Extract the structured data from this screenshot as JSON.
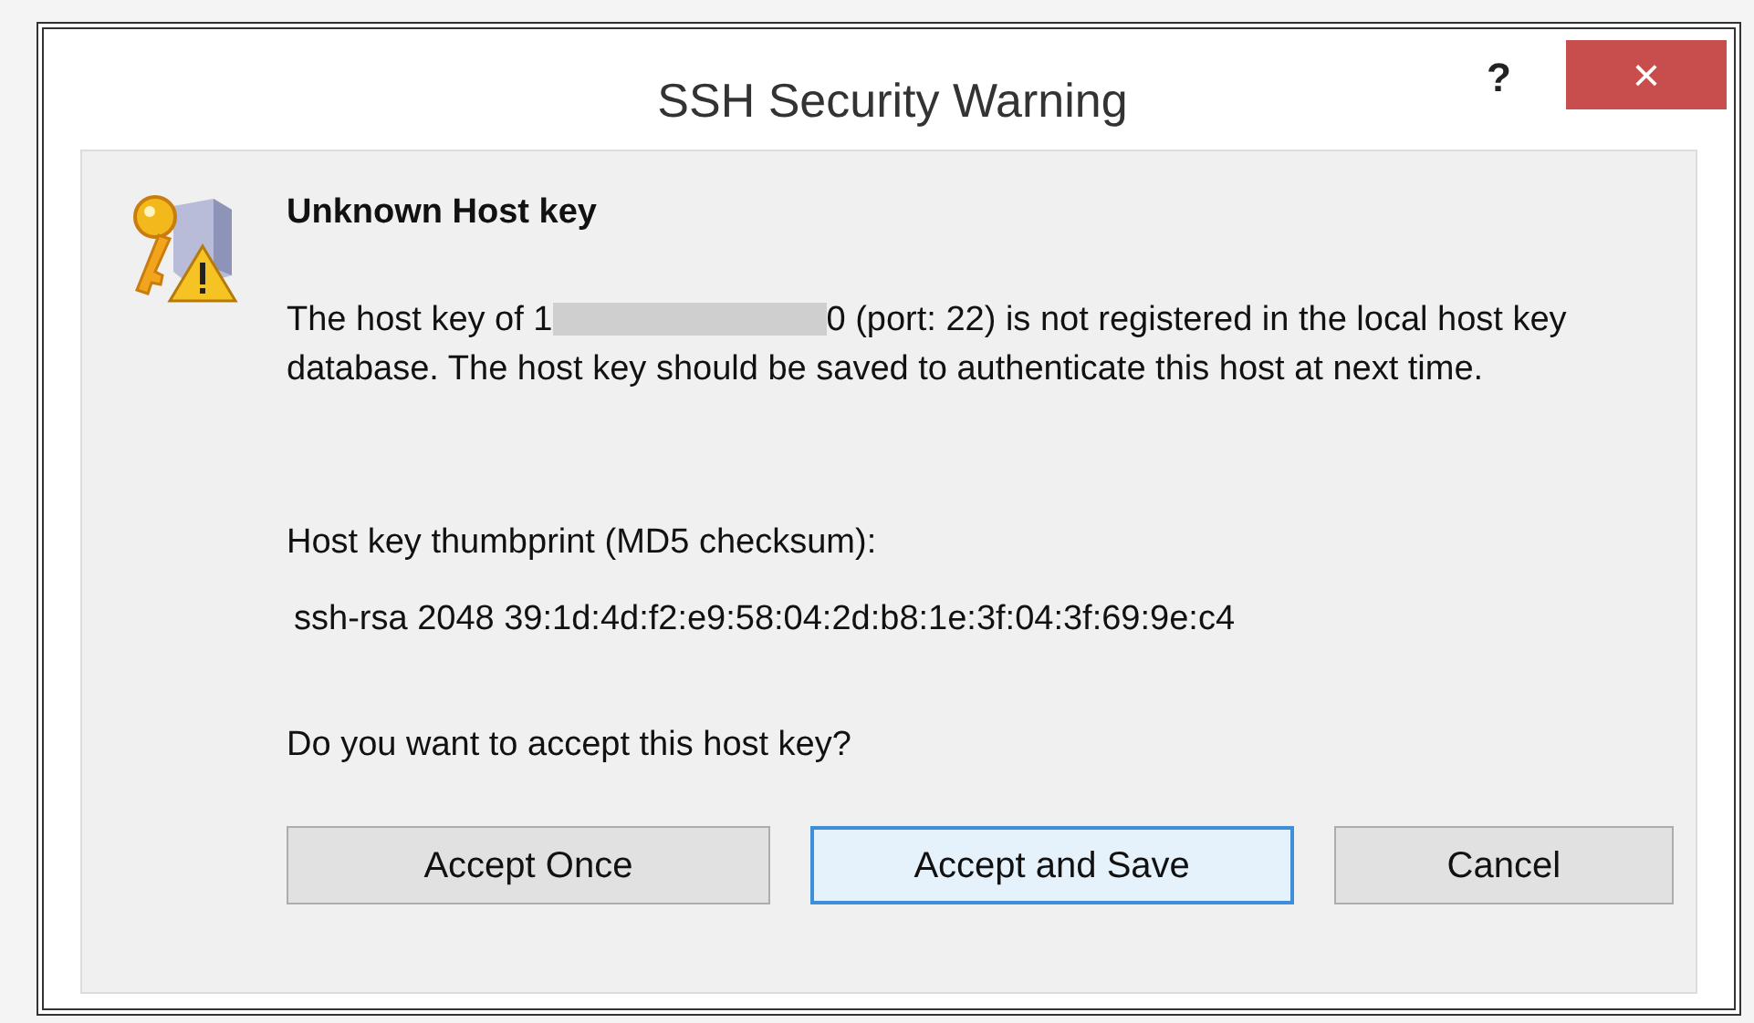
{
  "window": {
    "title": "SSH Security Warning",
    "help": "?",
    "close": "×"
  },
  "heading": "Unknown Host key",
  "message": {
    "before": "The host key of 1",
    "redacted": true,
    "after": "0 (port: 22) is not registered in the local host key database. The host key should be saved to authenticate this host at next time."
  },
  "thumbprint": {
    "label": "Host key thumbprint (MD5 checksum):",
    "value": "ssh-rsa 2048 39:1d:4d:f2:e9:58:04:2d:b8:1e:3f:04:3f:69:9e:c4"
  },
  "question": "Do you want to accept this host key?",
  "buttons": [
    {
      "label": "Accept Once",
      "selected": false
    },
    {
      "label": "Accept and Save",
      "selected": true
    },
    {
      "label": "Cancel",
      "selected": false
    }
  ]
}
